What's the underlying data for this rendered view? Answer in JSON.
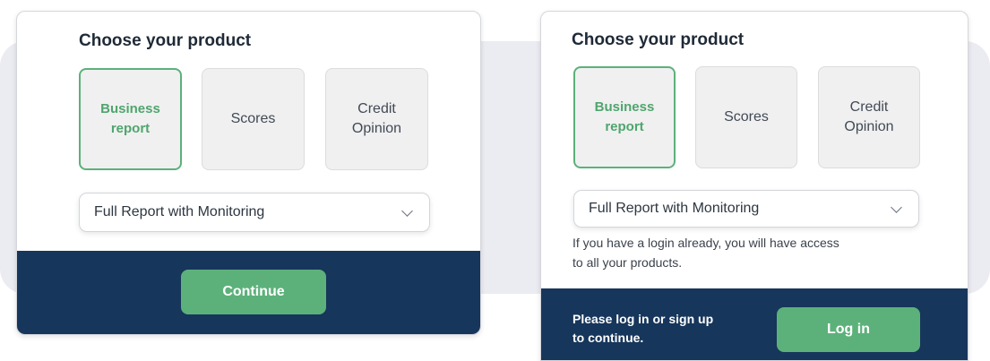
{
  "left_panel": {
    "title": "Choose your product",
    "options": [
      {
        "line1": "Business",
        "line2": "report",
        "selected": true
      },
      {
        "line1": "Scores",
        "line2": "",
        "selected": false
      },
      {
        "line1": "Credit",
        "line2": "Opinion",
        "selected": false
      }
    ],
    "dropdown_value": "Full Report with Monitoring",
    "continue_label": "Continue"
  },
  "right_panel": {
    "title": "Choose your product",
    "options": [
      {
        "line1": "Business",
        "line2": "report",
        "selected": true
      },
      {
        "line1": "Scores",
        "line2": "",
        "selected": false
      },
      {
        "line1": "Credit",
        "line2": "Opinion",
        "selected": false
      }
    ],
    "dropdown_value": "Full Report with Monitoring",
    "note_line1": "If you have a login already, you will have access",
    "note_line2": "to all your products.",
    "footer_line1": "Please log in or sign up",
    "footer_line2": "to continue.",
    "login_label": "Log in"
  },
  "colors": {
    "accent_green": "#5cb17a",
    "footer_navy": "#17365b",
    "backdrop": "#ebebf2"
  },
  "icons": {
    "dropdown": "chevron-down-icon"
  }
}
